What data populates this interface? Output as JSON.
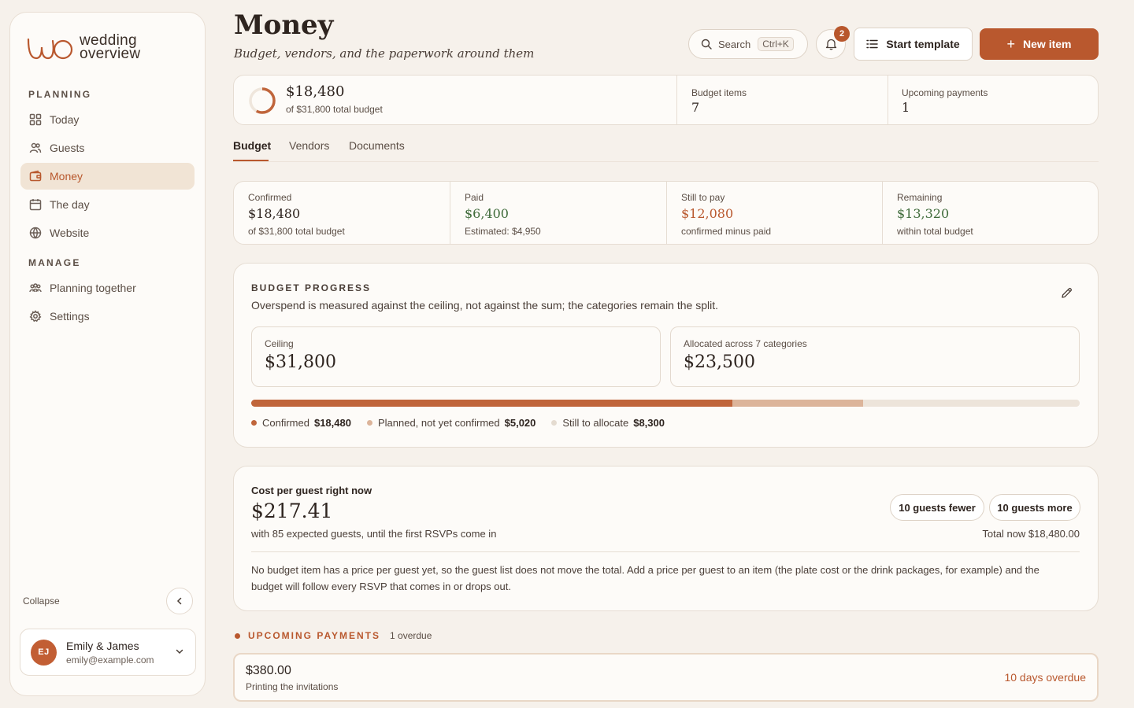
{
  "brand": {
    "line1": "wedding",
    "line2": "overview"
  },
  "sidebar": {
    "sections": [
      "PLANNING",
      "MANAGE"
    ],
    "items": [
      {
        "label": "Today",
        "icon": "grid-icon"
      },
      {
        "label": "Guests",
        "icon": "users-icon"
      },
      {
        "label": "Money",
        "icon": "wallet-icon",
        "active": true
      },
      {
        "label": "The day",
        "icon": "calendar-icon"
      },
      {
        "label": "Website",
        "icon": "globe-icon"
      },
      {
        "label": "Planning together",
        "icon": "group-icon"
      },
      {
        "label": "Settings",
        "icon": "gear-icon"
      }
    ],
    "collapse_label": "Collapse",
    "user": {
      "initials": "EJ",
      "name": "Emily & James",
      "email": "emily@example.com"
    }
  },
  "header": {
    "title": "Money",
    "subtitle": "Budget, vendors, and the paperwork around them",
    "search_label": "Search",
    "search_shortcut": "Ctrl+K",
    "notification_count": "2",
    "template_label": "Start template",
    "new_item_label": "New item",
    "accent": "#b9582e"
  },
  "summary": {
    "amount": "$18,480",
    "sub": "of $31,800 total budget",
    "budget_items_label": "Budget items",
    "budget_items_value": "7",
    "upcoming_label": "Upcoming payments",
    "upcoming_value": "1",
    "progress_fraction": 0.58
  },
  "tabs": [
    "Budget",
    "Vendors",
    "Documents"
  ],
  "stats": [
    {
      "label": "Confirmed",
      "value": "$18,480",
      "sub": "of $31,800 total budget",
      "color": "#2e241f"
    },
    {
      "label": "Paid",
      "value": "$6,400",
      "sub": "Estimated: $4,950",
      "color": "#3f6b3a"
    },
    {
      "label": "Still to pay",
      "value": "$12,080",
      "sub": "confirmed minus paid",
      "color": "#b9582e"
    },
    {
      "label": "Remaining",
      "value": "$13,320",
      "sub": "within total budget",
      "color": "#3f6b3a"
    }
  ],
  "budget_progress": {
    "title": "BUDGET PROGRESS",
    "description": "Overspend is measured against the ceiling, not against the sum; the categories remain the split.",
    "ceiling_label": "Ceiling",
    "ceiling_value": "$31,800",
    "allocated_label": "Allocated across 7 categories",
    "allocated_value": "$23,500",
    "total": 31800,
    "segments": [
      {
        "label": "Confirmed",
        "value_text": "$18,480",
        "value": 18480,
        "color": "#c0653b"
      },
      {
        "label": "Planned, not yet confirmed",
        "value_text": "$5,020",
        "value": 5020,
        "color": "#dcb49a"
      },
      {
        "label": "Still to allocate",
        "value_text": "$8,300",
        "value": 8300,
        "color": "#ede4da"
      }
    ]
  },
  "cost_per_guest": {
    "label": "Cost per guest right now",
    "value": "$217.41",
    "sub": "with 85 expected guests, until the first RSVPs come in",
    "fewer_label": "10 guests fewer",
    "more_label": "10 guests more",
    "total": "Total now $18,480.00",
    "note": "No budget item has a price per guest yet, so the guest list does not move the total. Add a price per guest to an item (the plate cost or the drink packages, for example) and the budget will follow every RSVP that comes in or drops out."
  },
  "upcoming_payments": {
    "title": "UPCOMING PAYMENTS",
    "count": "1 overdue",
    "items": [
      {
        "amount": "$380.00",
        "description": "Printing the invitations",
        "status": "10 days overdue"
      }
    ]
  }
}
